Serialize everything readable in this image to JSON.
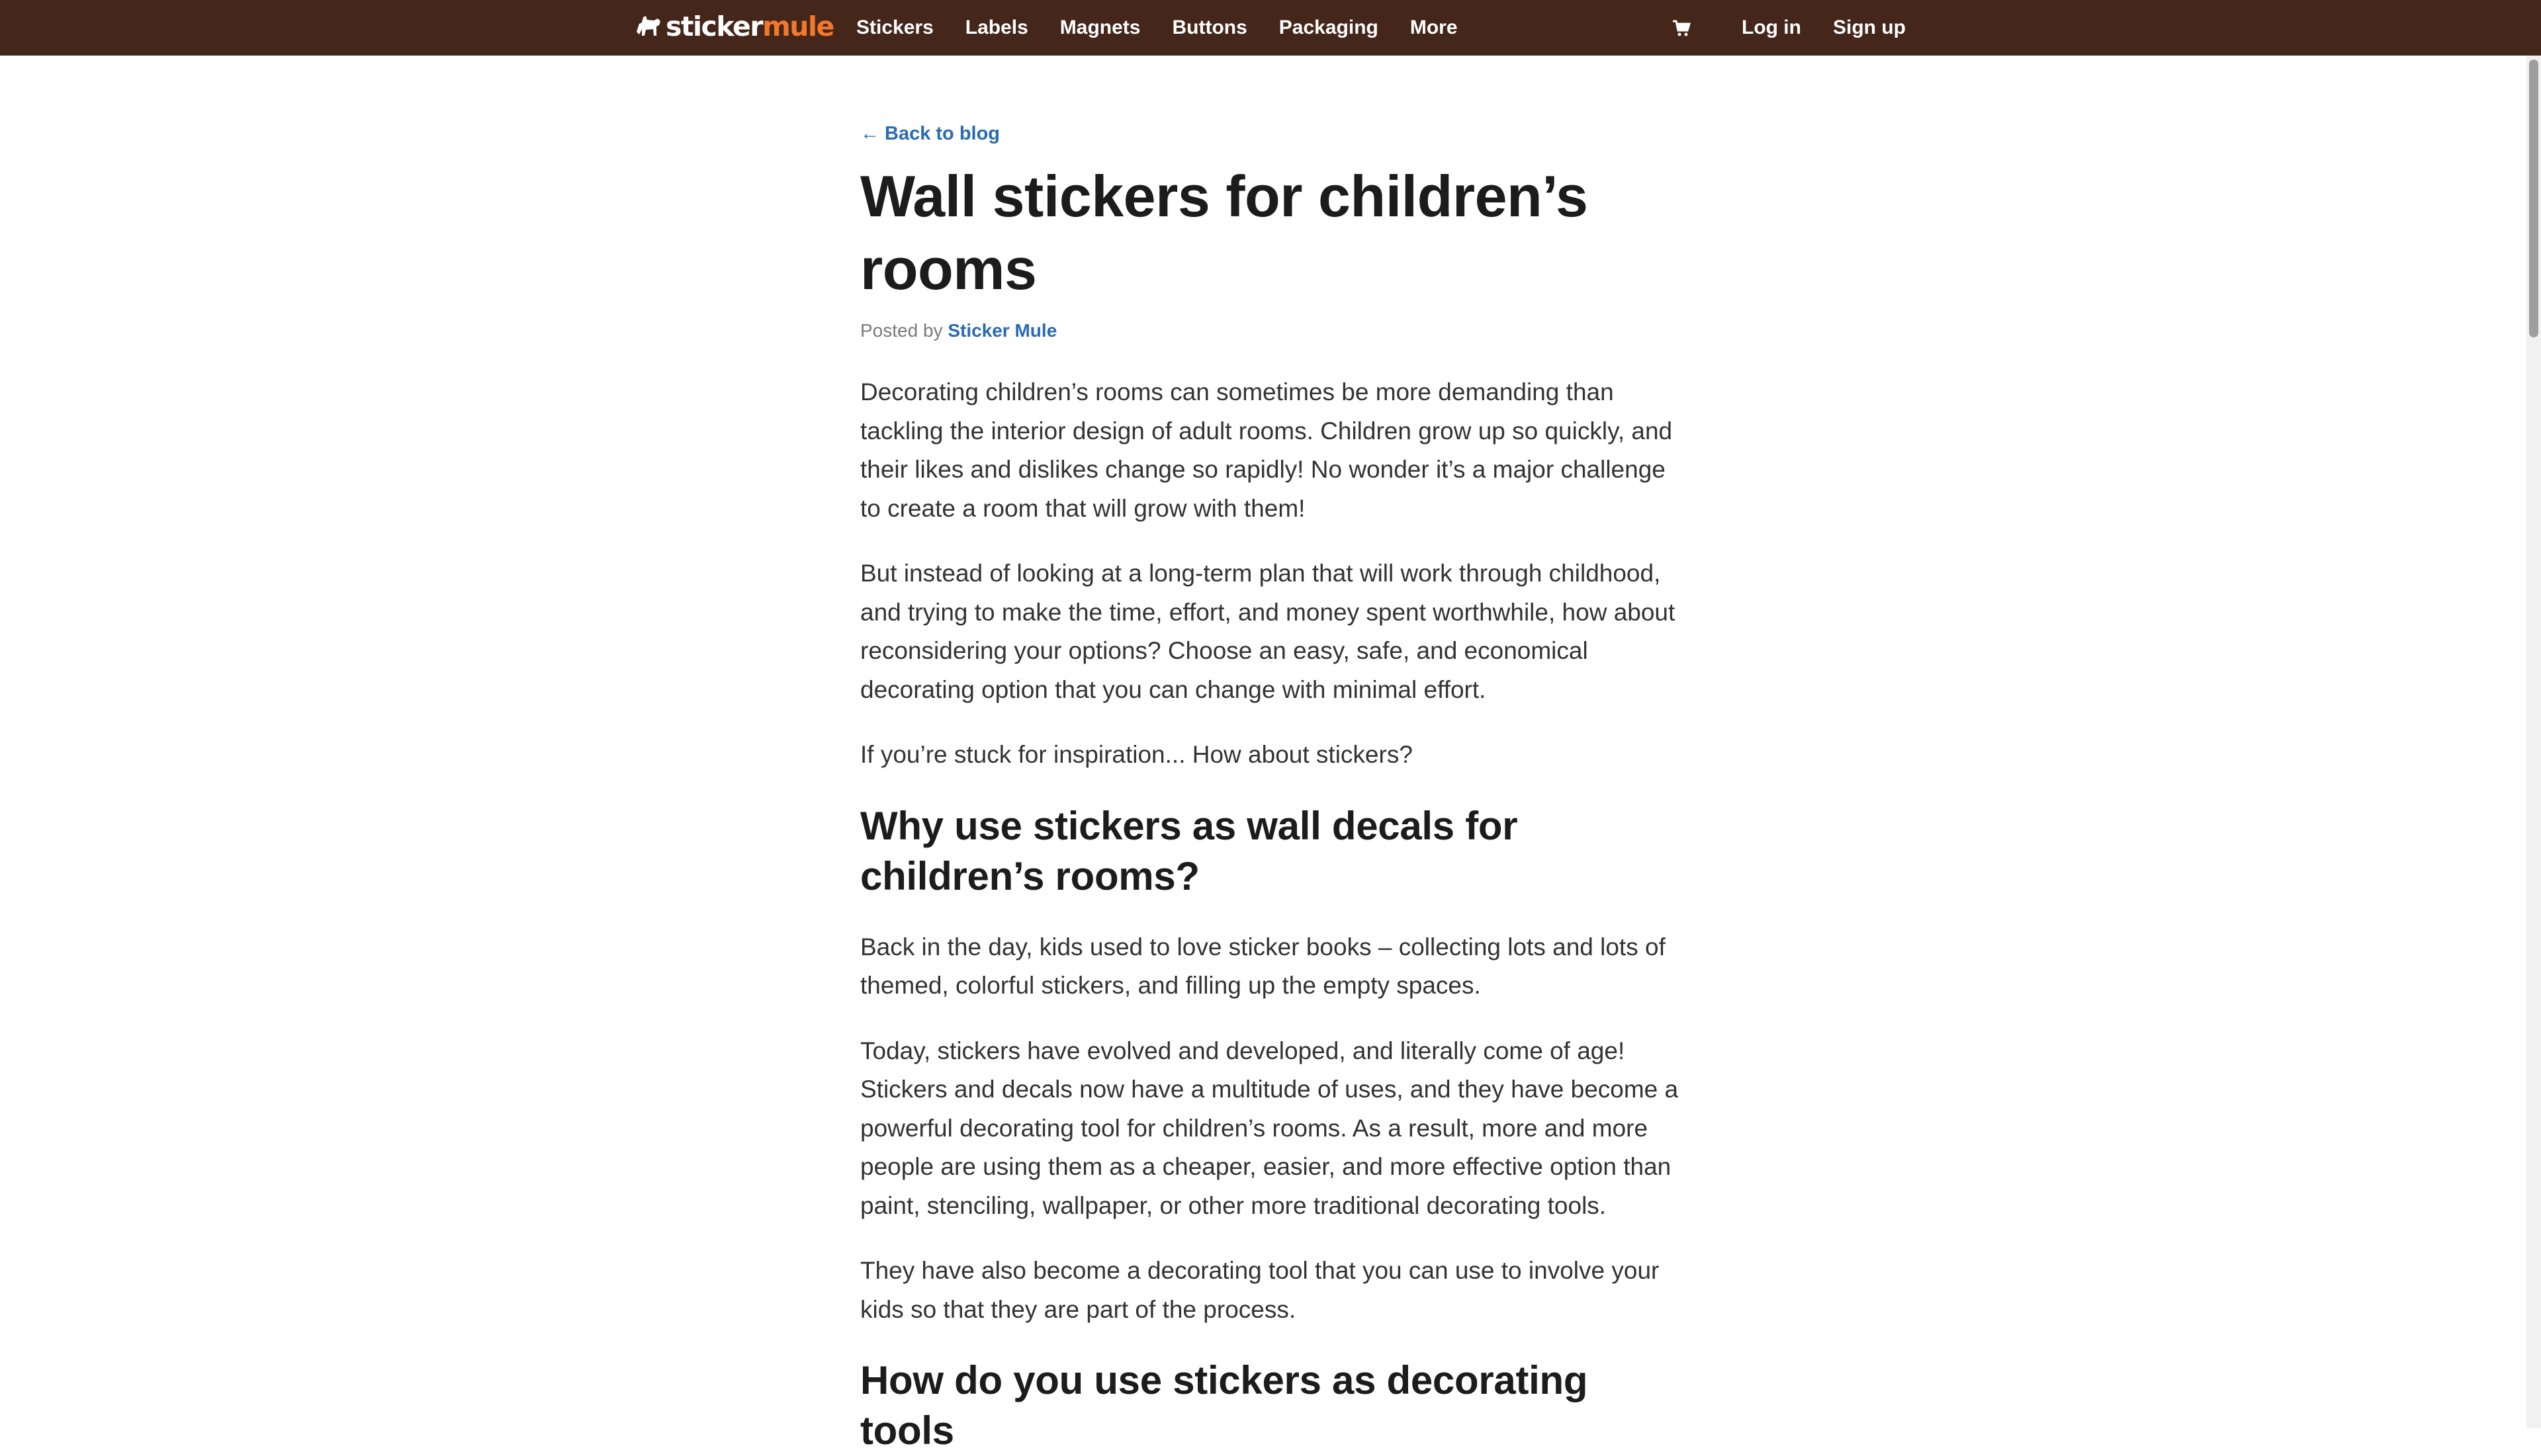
{
  "nav": {
    "logo_text_main": "sticker",
    "logo_text_accent": "mule",
    "links": [
      "Stickers",
      "Labels",
      "Magnets",
      "Buttons",
      "Packaging",
      "More"
    ],
    "login_label": "Log in",
    "signup_label": "Sign up",
    "cart_icon": "cart-icon"
  },
  "article": {
    "back_label": "Back to blog",
    "back_arrow": "←",
    "title": "Wall stickers for children’s rooms",
    "byline_prefix": "Posted by",
    "author": "Sticker Mule",
    "paragraphs": [
      "Decorating children’s rooms can sometimes be more demanding than tackling the interior design of adult rooms. Children grow up so quickly, and their likes and dislikes change so rapidly! No wonder it’s a major challenge to create a room that will grow with them!",
      "But instead of looking at a long-term plan that will work through childhood, and trying to make the time, effort, and money spent worthwhile, how about reconsidering your options? Choose an easy, safe, and economical decorating option that you can change with minimal effort.",
      "If you’re stuck for inspiration... How about stickers?"
    ],
    "heading_1": "Why use stickers as wall decals for children’s rooms?",
    "paragraphs_2": [
      "Back in the day, kids used to love sticker books – collecting lots and lots of themed, colorful stickers, and filling up the empty spaces.",
      "Today, stickers have evolved and developed, and literally come of age! Stickers and decals now have a multitude of uses, and they have become a powerful decorating tool for children’s rooms. As a result, more and more people are using them as a cheaper, easier, and more effective option than paint, stenciling, wallpaper, or other more traditional decorating tools.",
      "They have also become a decorating tool that you can use to involve your kids so that they are part of the process."
    ],
    "heading_2": "How do you use stickers as decorating tools"
  },
  "colors": {
    "nav_bg": "#45261a",
    "logo_accent": "#f4772e",
    "link_blue": "#2a6bb0"
  }
}
